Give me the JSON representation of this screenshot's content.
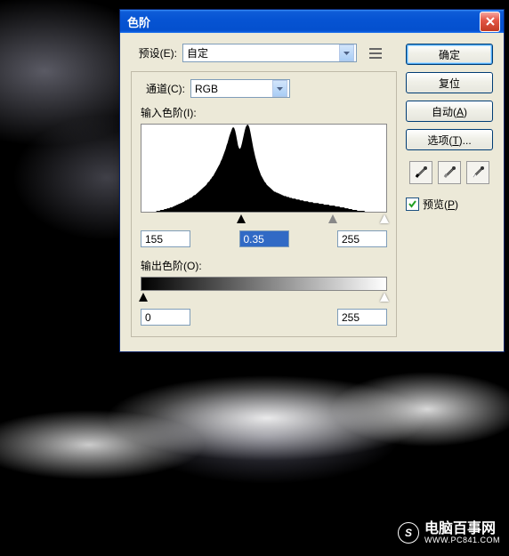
{
  "window": {
    "title": "色阶"
  },
  "preset": {
    "label": "预设(E):",
    "value": "自定"
  },
  "channel": {
    "label": "通道(C):",
    "value": "RGB"
  },
  "input_levels": {
    "label": "输入色阶(I):",
    "shadow": "155",
    "mid": "0.35",
    "highlight": "255"
  },
  "output_levels": {
    "label": "输出色阶(O):",
    "low": "0",
    "high": "255"
  },
  "buttons": {
    "ok": "确定",
    "cancel": "复位",
    "auto": "自动(A)",
    "options": "选项(T)..."
  },
  "preview": {
    "label": "预览(P)",
    "checked": true
  },
  "watermark": {
    "name": "电脑百事网",
    "url": "WWW.PC841.COM"
  },
  "chart_data": {
    "type": "histogram",
    "xlim": [
      0,
      255
    ],
    "ylim": [
      0,
      100
    ],
    "values": [
      0,
      0,
      0,
      0,
      0,
      0,
      0,
      0,
      0,
      0,
      0,
      0,
      0,
      0,
      0,
      0,
      1,
      1,
      1,
      1,
      2,
      2,
      2,
      2,
      3,
      3,
      3,
      4,
      4,
      4,
      5,
      5,
      5,
      6,
      6,
      7,
      7,
      8,
      8,
      9,
      9,
      10,
      10,
      11,
      11,
      12,
      13,
      13,
      14,
      14,
      15,
      16,
      16,
      17,
      18,
      19,
      19,
      20,
      21,
      22,
      23,
      24,
      25,
      26,
      27,
      28,
      29,
      30,
      31,
      33,
      34,
      35,
      37,
      38,
      40,
      41,
      43,
      45,
      47,
      49,
      51,
      53,
      55,
      58,
      60,
      63,
      66,
      69,
      72,
      76,
      79,
      83,
      87,
      90,
      93,
      96,
      97,
      96,
      93,
      88,
      82,
      76,
      73,
      72,
      74,
      78,
      83,
      88,
      93,
      97,
      99,
      100,
      99,
      96,
      91,
      85,
      79,
      73,
      68,
      63,
      59,
      55,
      51,
      48,
      45,
      42,
      40,
      38,
      36,
      34,
      33,
      31,
      30,
      29,
      28,
      27,
      26,
      25,
      24,
      23,
      23,
      22,
      22,
      21,
      21,
      20,
      20,
      19,
      19,
      18,
      18,
      18,
      17,
      17,
      17,
      16,
      16,
      16,
      15,
      15,
      15,
      15,
      14,
      14,
      14,
      14,
      13,
      13,
      13,
      13,
      12,
      12,
      12,
      12,
      12,
      11,
      11,
      11,
      11,
      11,
      10,
      10,
      10,
      10,
      10,
      10,
      9,
      9,
      9,
      9,
      9,
      8,
      8,
      8,
      8,
      8,
      8,
      7,
      7,
      7,
      7,
      7,
      7,
      6,
      6,
      6,
      6,
      6,
      5,
      5,
      5,
      5,
      5,
      4,
      4,
      4,
      4,
      3,
      3,
      3,
      3,
      2,
      2,
      2,
      2,
      2,
      1,
      1,
      1,
      1,
      1,
      1,
      1,
      1,
      0,
      0,
      0,
      0,
      0,
      0,
      0,
      0,
      0,
      0,
      0,
      0,
      0,
      0,
      0,
      0,
      0,
      0,
      0,
      0,
      0,
      0
    ]
  }
}
